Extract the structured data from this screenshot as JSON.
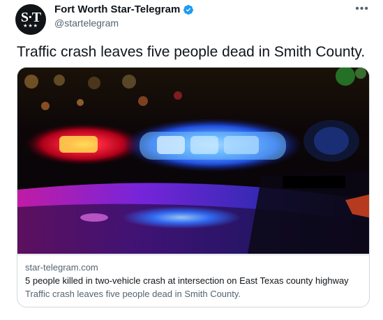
{
  "author": {
    "display_name": "Fort Worth Star-Telegram",
    "handle": "@startelegram",
    "avatar_text": "S·T",
    "avatar_stars": "★★★",
    "verified": true
  },
  "menu": {
    "more_label": "•••"
  },
  "tweet": {
    "text": "Traffic crash leaves five people dead in Smith County."
  },
  "card": {
    "image_icon": "police-light-photo",
    "domain": "star-telegram.com",
    "title": "5 people killed in two-vehicle crash at intersection on East Texas county highway",
    "description": "Traffic crash leaves five people dead in Smith County."
  },
  "colors": {
    "verified_blue": "#1d9bf0",
    "muted_text": "#536471",
    "border": "#cfd9de"
  }
}
